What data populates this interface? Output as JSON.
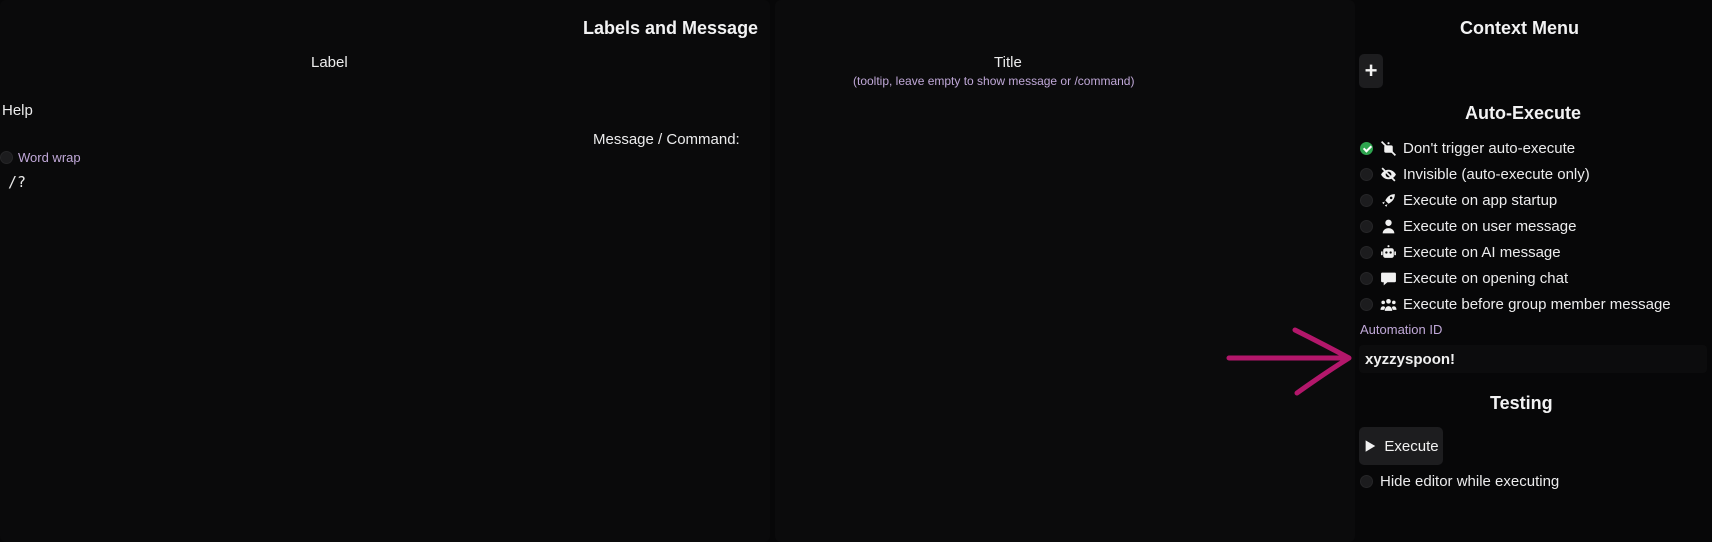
{
  "left_panel": {
    "title": "Labels and Message",
    "label_header": "Label",
    "title_header": "Title",
    "title_hint": "(tooltip, leave empty to show message or /command)",
    "help_label": "Help",
    "message_label": "Message / Command:",
    "word_wrap_label": "Word wrap",
    "command_value": "/?"
  },
  "context_menu": {
    "title": "Context Menu",
    "add_label": "+"
  },
  "auto_execute": {
    "title": "Auto-Execute",
    "options": [
      {
        "label": "Don't trigger auto-execute",
        "icon": "robot-slash-icon",
        "checked": true
      },
      {
        "label": "Invisible (auto-execute only)",
        "icon": "eye-slash-icon",
        "checked": false
      },
      {
        "label": "Execute on app startup",
        "icon": "rocket-icon",
        "checked": false
      },
      {
        "label": "Execute on user message",
        "icon": "user-icon",
        "checked": false
      },
      {
        "label": "Execute on AI message",
        "icon": "robot-icon",
        "checked": false
      },
      {
        "label": "Execute on opening chat",
        "icon": "comment-icon",
        "checked": false
      },
      {
        "label": "Execute before group member message",
        "icon": "people-group-icon",
        "checked": false
      }
    ],
    "automation_id_label": "Automation ID",
    "automation_id_value": "xyzzyspoon!"
  },
  "testing": {
    "title": "Testing",
    "execute_label": "Execute",
    "hide_editor_label": "Hide editor while executing"
  },
  "annotation": {
    "arrow_color": "#b3176b"
  }
}
